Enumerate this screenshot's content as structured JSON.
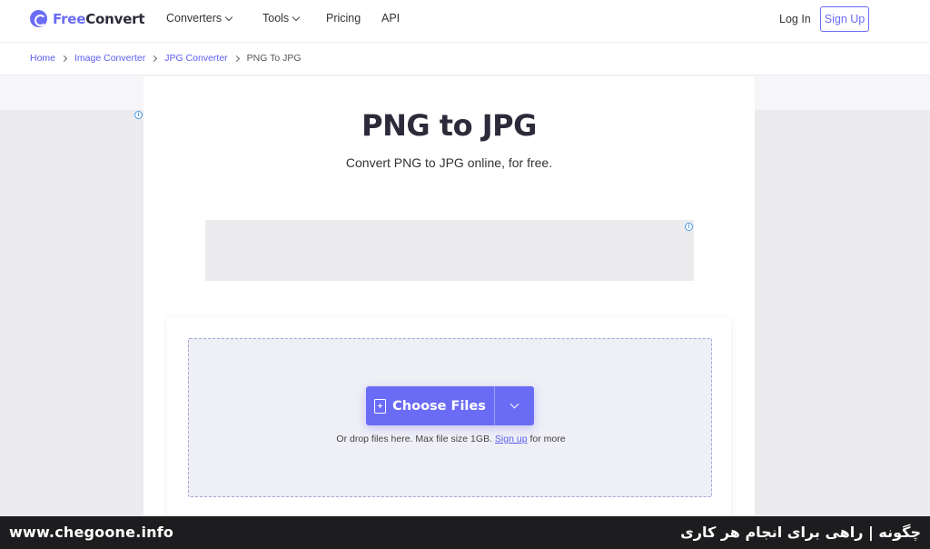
{
  "brand": {
    "part1": "Free",
    "part2": "Convert"
  },
  "nav": {
    "converters": "Converters",
    "tools": "Tools",
    "pricing": "Pricing",
    "api": "API"
  },
  "auth": {
    "login": "Log In",
    "signup": "Sign Up"
  },
  "breadcrumb": [
    "Home",
    "Image Converter",
    "JPG Converter",
    "PNG To JPG"
  ],
  "page": {
    "title": "PNG to JPG",
    "subtitle": "Convert PNG to JPG online, for free."
  },
  "upload": {
    "button_label": "Choose Files",
    "hint_prefix": "Or drop files here. Max file size 1GB.",
    "hint_link": "Sign up",
    "hint_suffix": "for more"
  },
  "ad_info_glyph": "i",
  "watermark": {
    "left": "www.chegoone.info",
    "right": "چگونه | راهی برای انجام هر کاری"
  },
  "colors": {
    "accent": "#6a6cf6",
    "link": "#5b5df2",
    "dropzone_bg": "#efeff6",
    "ad_placeholder": "#ececef"
  }
}
